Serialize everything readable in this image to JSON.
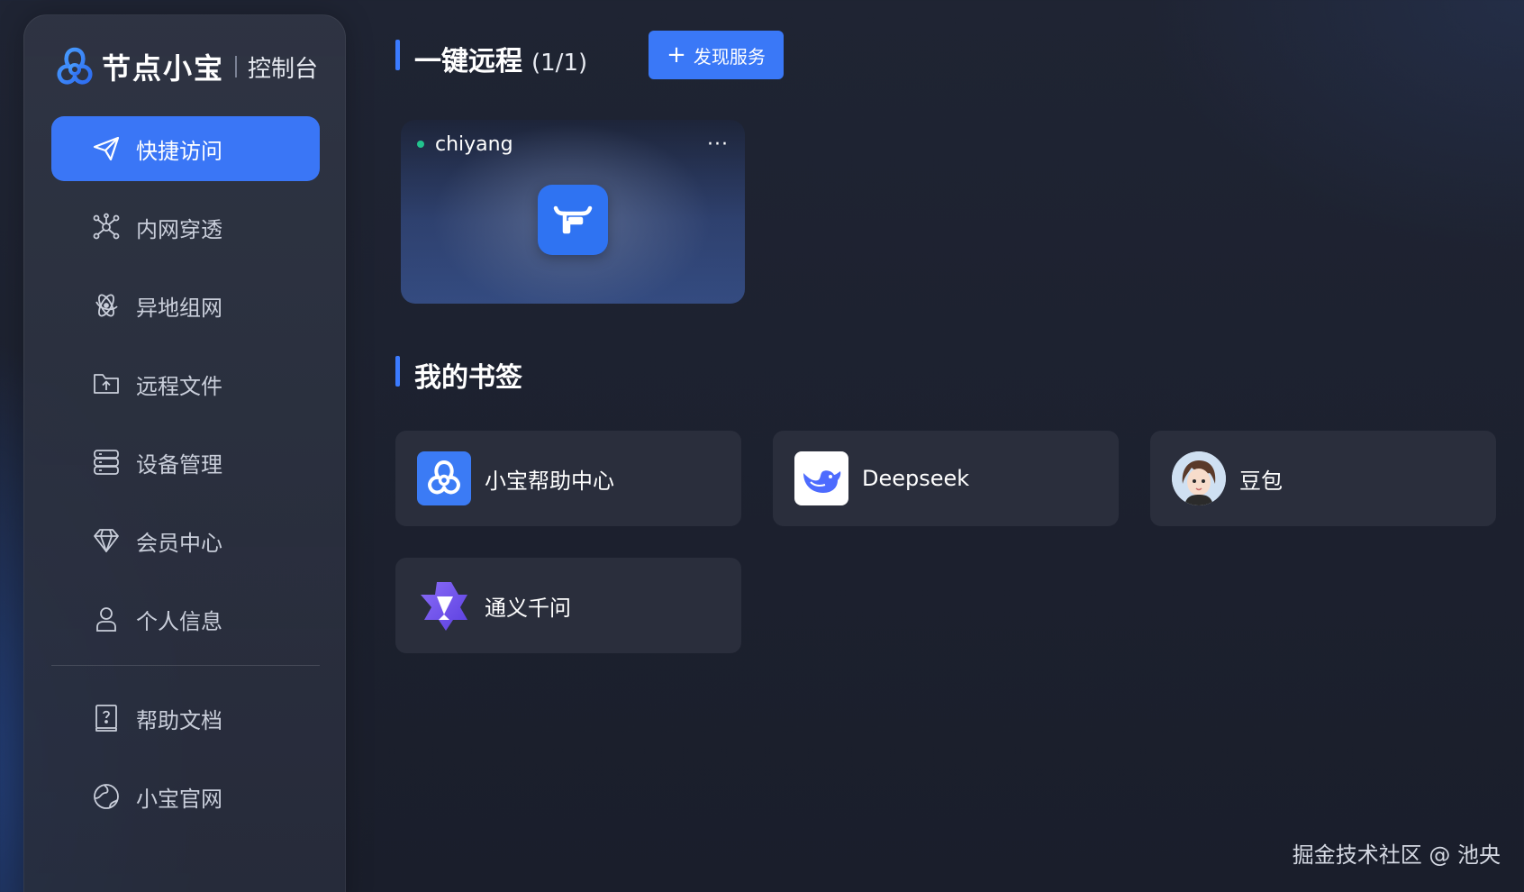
{
  "brand": {
    "name": "节点小宝",
    "subtitle": "控制台"
  },
  "sidebar": {
    "items": [
      {
        "label": "快捷访问",
        "icon": "paper-plane-icon",
        "active": true
      },
      {
        "label": "内网穿透",
        "icon": "network-nodes-icon"
      },
      {
        "label": "异地组网",
        "icon": "atom-icon"
      },
      {
        "label": "远程文件",
        "icon": "folder-upload-icon"
      },
      {
        "label": "设备管理",
        "icon": "server-icon"
      },
      {
        "label": "会员中心",
        "icon": "diamond-icon"
      },
      {
        "label": "个人信息",
        "icon": "user-icon"
      }
    ],
    "bottom_items": [
      {
        "label": "帮助文档",
        "icon": "help-book-icon"
      },
      {
        "label": "小宝官网",
        "icon": "globe-icon"
      }
    ]
  },
  "remote": {
    "title": "一键远程",
    "count": "(1/1)",
    "discover_label": "发现服务",
    "device": {
      "name": "chiyang",
      "status": "online",
      "status_color": "#22c38e",
      "more": "···"
    }
  },
  "bookmarks": {
    "title": "我的书签",
    "items": [
      {
        "label": "小宝帮助中心",
        "icon": "xiaobao-logo-icon"
      },
      {
        "label": "Deepseek",
        "icon": "deepseek-whale-icon"
      },
      {
        "label": "豆包",
        "icon": "doubao-avatar-icon"
      },
      {
        "label": "通义千问",
        "icon": "tongyi-qianwen-icon"
      }
    ]
  },
  "watermark": "掘金技术社区 @ 池央",
  "colors": {
    "accent": "#3a76f6",
    "online": "#22c38e"
  }
}
